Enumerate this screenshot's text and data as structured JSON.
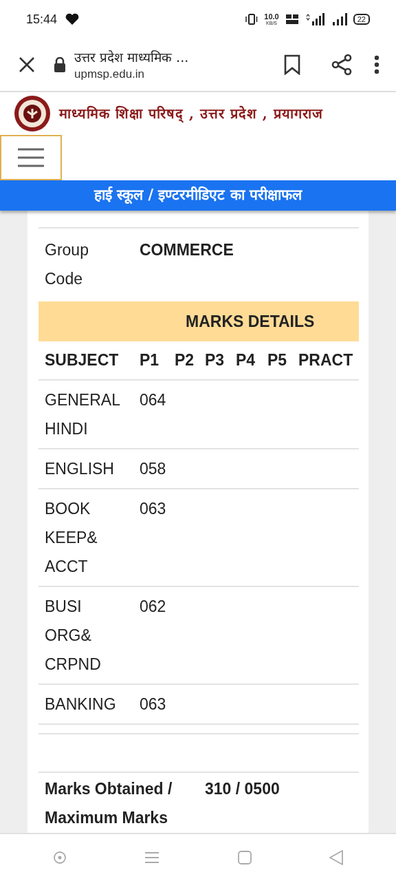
{
  "status_bar": {
    "time": "15:44",
    "speed_value": "10.0",
    "speed_unit": "KB/S",
    "battery": "22"
  },
  "browser_bar": {
    "title": "उत्तर प्रदेश माध्यमिक ...",
    "url": "upmsp.edu.in"
  },
  "site_header": {
    "title": "माध्यमिक शिक्षा परिषद् , उत्तर प्रदेश , प्रयागराज"
  },
  "banner": "हाई स्कूल / इण्टरमीडिएट का परीक्षाफल",
  "group_code": {
    "label": "Group Code",
    "value": "COMMERCE"
  },
  "marks_table": {
    "title": "MARKS DETAILS",
    "columns": [
      "SUBJECT",
      "P1",
      "P2",
      "P3",
      "P4",
      "P5",
      "PRACT"
    ],
    "rows": [
      {
        "subject": "GENERAL HINDI",
        "p1": "064"
      },
      {
        "subject": "ENGLISH",
        "p1": "058"
      },
      {
        "subject": "BOOK KEEP& ACCT",
        "p1": "063"
      },
      {
        "subject": "BUSI ORG& CRPND",
        "p1": "062"
      },
      {
        "subject": "BANKING",
        "p1": "063"
      }
    ]
  },
  "total": {
    "label": "Marks Obtained / Maximum Marks",
    "value": "310 / 0500"
  }
}
